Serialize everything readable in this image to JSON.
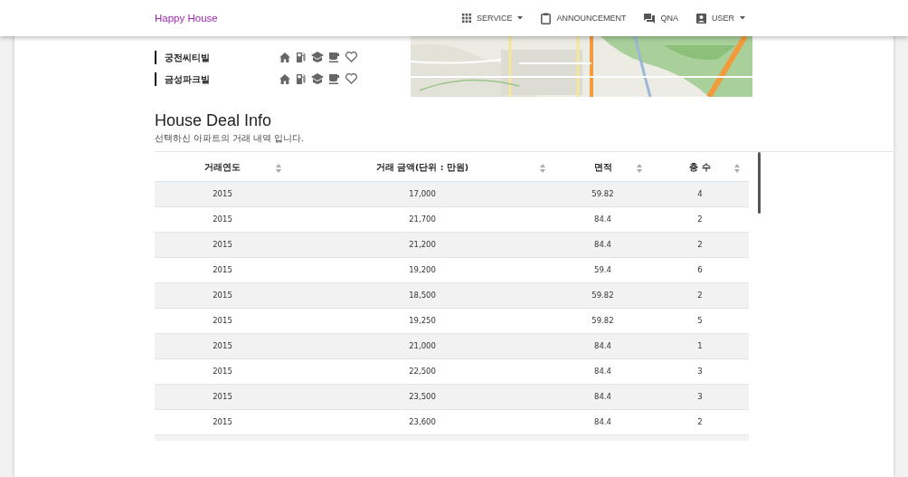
{
  "brand": "Happy House",
  "nav": [
    {
      "label": "SERVICE",
      "dropdown": true
    },
    {
      "label": "ANNOUNCEMENT",
      "dropdown": false
    },
    {
      "label": "QNA",
      "dropdown": false
    },
    {
      "label": "USER",
      "dropdown": true
    }
  ],
  "apartments": [
    {
      "name": "궁전씨티빌"
    },
    {
      "name": "금성파크빌"
    }
  ],
  "section": {
    "title": "House Deal Info",
    "subtitle": "선택하신 아파트의 거래 내역 입니다."
  },
  "table": {
    "columns": [
      "거래연도",
      "거래 금액(단위 : 만원)",
      "면적",
      "충 수"
    ],
    "rows": [
      {
        "cells": [
          "2015",
          "17,000",
          "59.82",
          "4"
        ]
      },
      {
        "cells": [
          "2015",
          "21,700",
          "84.4",
          "2"
        ]
      },
      {
        "cells": [
          "2015",
          "21,200",
          "84.4",
          "2"
        ]
      },
      {
        "cells": [
          "2015",
          "19,200",
          "59.4",
          "6"
        ]
      },
      {
        "cells": [
          "2015",
          "18,500",
          "59.82",
          "2"
        ]
      },
      {
        "cells": [
          "2015",
          "19,250",
          "59.82",
          "5"
        ]
      },
      {
        "cells": [
          "2015",
          "21,000",
          "84.4",
          "1"
        ]
      },
      {
        "cells": [
          "2015",
          "22,500",
          "84.4",
          "3"
        ]
      },
      {
        "cells": [
          "2015",
          "23,500",
          "84.4",
          "3"
        ]
      },
      {
        "cells": [
          "2015",
          "23,600",
          "84.4",
          "2"
        ]
      }
    ]
  }
}
